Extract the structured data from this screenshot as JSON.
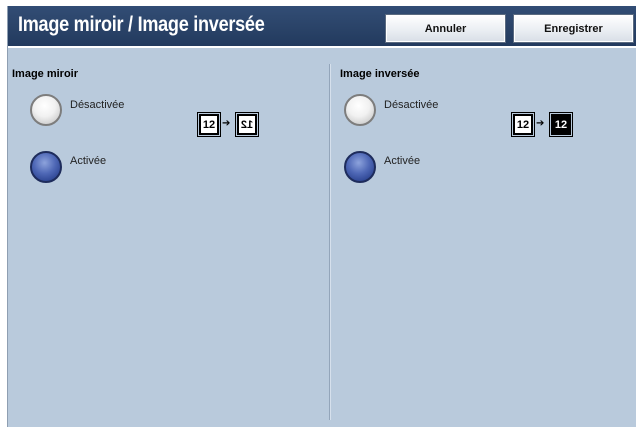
{
  "header": {
    "title": "Image miroir / Image inversée",
    "cancel_label": "Annuler",
    "save_label": "Enregistrer"
  },
  "mirror": {
    "heading": "Image miroir",
    "options": [
      {
        "label": "Désactivée",
        "selected": false
      },
      {
        "label": "Activée",
        "selected": true
      }
    ],
    "icon_text": "12",
    "arrow": "➔"
  },
  "inverse": {
    "heading": "Image inversée",
    "options": [
      {
        "label": "Désactivée",
        "selected": false
      },
      {
        "label": "Activée",
        "selected": true
      }
    ],
    "icon_text": "12",
    "arrow": "➔"
  },
  "colors": {
    "header_bg": "#2a4368",
    "panel_bg": "#b9cadc",
    "radio_selected": "#3a55a4"
  }
}
